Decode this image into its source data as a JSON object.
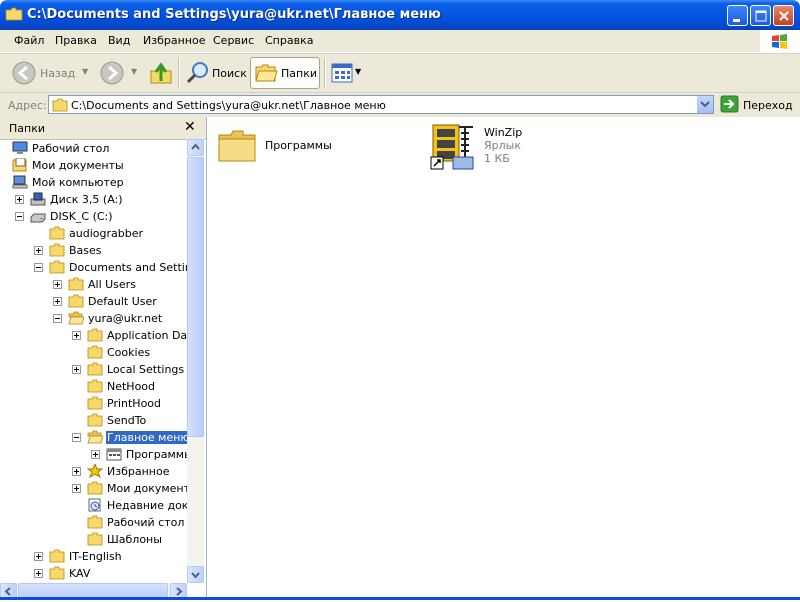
{
  "window": {
    "title": "C:\\Documents and Settings\\yura@ukr.net\\Главное меню"
  },
  "menu": [
    "Файл",
    "Правка",
    "Вид",
    "Избранное",
    "Сервис",
    "Справка"
  ],
  "toolbar": {
    "back_label": "Назад",
    "search_label": "Поиск",
    "folders_label": "Папки"
  },
  "address": {
    "label": "Адрес:",
    "value": "C:\\Documents and Settings\\yura@ukr.net\\Главное меню",
    "go_label": "Переход"
  },
  "folders_panel": {
    "title": "Папки",
    "tree": [
      {
        "label": "Рабочий стол",
        "icon": "desktop-icon",
        "expander": "none"
      },
      {
        "label": "Мои документы",
        "icon": "my-documents-icon",
        "expander": "none"
      },
      {
        "label": "Мой компьютер",
        "icon": "my-computer-icon",
        "expander": "none"
      },
      {
        "label": "Диск 3,5 (A:)",
        "icon": "floppy-drive-icon",
        "expander": "plus"
      },
      {
        "label": "DISK_C (C:)",
        "icon": "hard-drive-icon",
        "expander": "minus"
      },
      {
        "label": "audiograbber",
        "icon": "folder-icon",
        "expander": "none"
      },
      {
        "label": "Bases",
        "icon": "folder-icon",
        "expander": "plus"
      },
      {
        "label": "Documents and Settings",
        "icon": "folder-icon",
        "expander": "minus"
      },
      {
        "label": "All Users",
        "icon": "folder-icon",
        "expander": "plus"
      },
      {
        "label": "Default User",
        "icon": "folder-icon",
        "expander": "plus"
      },
      {
        "label": "yura@ukr.net",
        "icon": "folder-open-icon",
        "expander": "minus"
      },
      {
        "label": "Application Data",
        "icon": "folder-icon",
        "expander": "plus"
      },
      {
        "label": "Cookies",
        "icon": "folder-icon",
        "expander": "none"
      },
      {
        "label": "Local Settings",
        "icon": "folder-icon",
        "expander": "plus"
      },
      {
        "label": "NetHood",
        "icon": "folder-icon",
        "expander": "none"
      },
      {
        "label": "PrintHood",
        "icon": "folder-icon",
        "expander": "none"
      },
      {
        "label": "SendTo",
        "icon": "folder-icon",
        "expander": "none"
      },
      {
        "label": "Главное меню",
        "icon": "folder-open-icon",
        "expander": "minus",
        "selected": true
      },
      {
        "label": "Программы",
        "icon": "programs-icon",
        "expander": "plus"
      },
      {
        "label": "Избранное",
        "icon": "favorites-star-icon",
        "expander": "plus"
      },
      {
        "label": "Мои документы",
        "icon": "folder-icon",
        "expander": "plus"
      },
      {
        "label": "Недавние докум",
        "icon": "recent-documents-icon",
        "expander": "none"
      },
      {
        "label": "Рабочий стол",
        "icon": "folder-icon",
        "expander": "none"
      },
      {
        "label": "Шаблоны",
        "icon": "folder-icon",
        "expander": "none"
      },
      {
        "label": "IT-English",
        "icon": "folder-icon",
        "expander": "plus"
      },
      {
        "label": "KAV",
        "icon": "folder-icon",
        "expander": "plus"
      }
    ]
  },
  "content": {
    "items": [
      {
        "name": "Программы",
        "icon": "folder-icon"
      },
      {
        "name": "WinZip",
        "type": "Ярлык",
        "size": "1 КБ",
        "icon": "winzip-shortcut-icon"
      }
    ]
  },
  "colors": {
    "titlebar": "#0554e3",
    "selection": "#316ac5",
    "chrome": "#ece9d8",
    "folder": "#f5d87a"
  }
}
